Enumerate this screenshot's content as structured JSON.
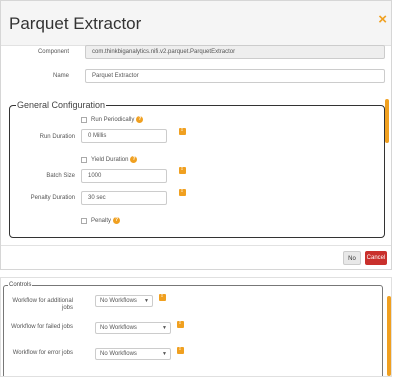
{
  "dialog": {
    "title": "Parquet Extractor",
    "close_glyph": "×",
    "component_label": "Component",
    "component_value": "com.thinkbiganalytics.nifi.v2.parquet.ParquetExtractor",
    "name_label": "Name",
    "name_value": "Parquet Extractor",
    "section_title": "General Configuration",
    "checkbox_top_label": "Run Periodically",
    "period_label": "Run Duration",
    "period_value": "0 Millis",
    "checkbox_mid_label": "Yield Duration",
    "batch_label": "Batch Size",
    "batch_value": "1000",
    "penalty_label": "Penalty Duration",
    "penalty_value": "30 sec",
    "checkbox_bottom_label": "Penalty",
    "no_button": "No",
    "cancel_button": "Cancel"
  },
  "panel2": {
    "section_title": "Controls",
    "rows": [
      {
        "label": "Workflow for additional jobs",
        "value": "No Workflows"
      },
      {
        "label": "Workflow for failed jobs",
        "value": "No Workflows"
      },
      {
        "label": "Workflow for error jobs",
        "value": "No Workflows"
      }
    ]
  },
  "colors": {
    "accent": "#f0a020",
    "danger": "#c9302c"
  },
  "icons": {
    "close": "close-icon",
    "info": "info-icon",
    "warn": "warning-icon",
    "caret": "chevron-down-icon"
  }
}
